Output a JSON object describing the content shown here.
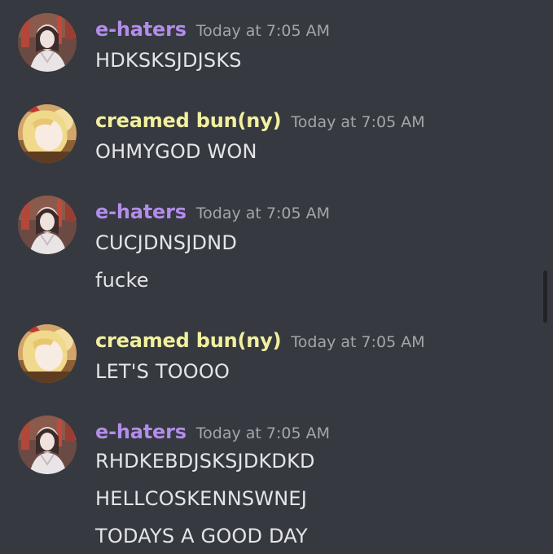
{
  "messages": [
    {
      "author": "e-haters",
      "avatar": "avatar-e-haters",
      "author_color": "#b28dea",
      "timestamp": "Today at 7:05 AM",
      "lines": [
        "HDKSKSJDJSKS"
      ]
    },
    {
      "author": "creamed bun(ny)",
      "avatar": "avatar-creamed-bunny",
      "author_color": "#f2f0a0",
      "timestamp": "Today at 7:05 AM",
      "lines": [
        "OHMYGOD WON"
      ]
    },
    {
      "author": "e-haters",
      "avatar": "avatar-e-haters",
      "author_color": "#b28dea",
      "timestamp": "Today at 7:05 AM",
      "lines": [
        "CUCJDNSJDND",
        "fucke"
      ]
    },
    {
      "author": "creamed bun(ny)",
      "avatar": "avatar-creamed-bunny",
      "author_color": "#f2f0a0",
      "timestamp": "Today at 7:05 AM",
      "lines": [
        "LET'S TOOOO"
      ]
    },
    {
      "author": "e-haters",
      "avatar": "avatar-e-haters",
      "author_color": "#b28dea",
      "timestamp": "Today at 7:05 AM",
      "lines": [
        "RHDKEBDJSKSJDKDKD",
        "HELLCOSKENNSWNEJ",
        "TODAYS A GOOD DAY"
      ]
    }
  ],
  "colors": {
    "background": "#36393f",
    "message_text": "#e3e5e8",
    "timestamp": "#a3a6aa",
    "scrollbar": "#202225"
  }
}
